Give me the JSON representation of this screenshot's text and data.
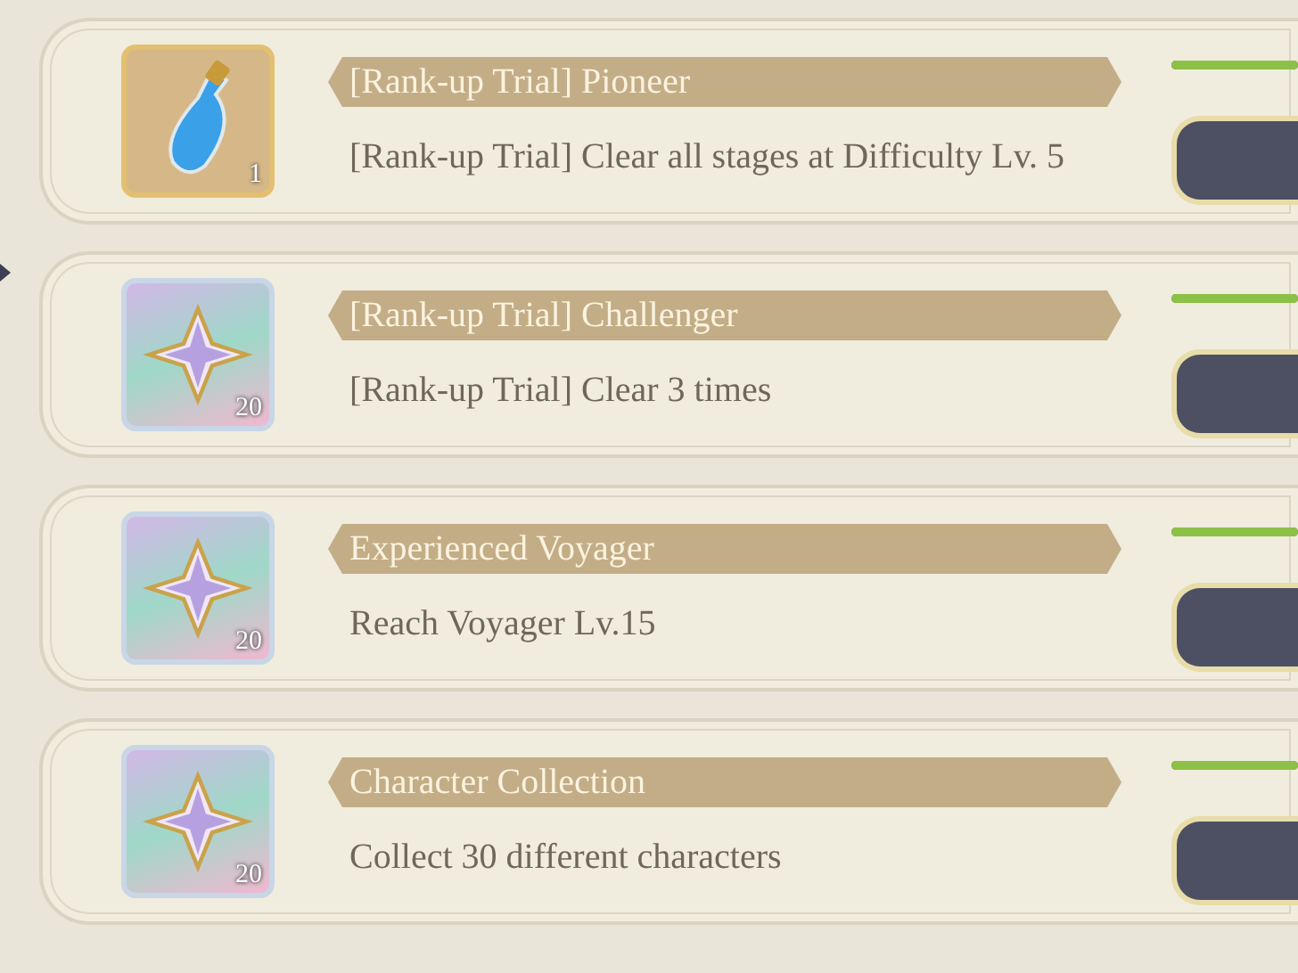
{
  "quests": [
    {
      "reward": {
        "kind": "potion",
        "count": "1"
      },
      "title": "[Rank-up Trial] Pioneer",
      "description": "[Rank-up Trial] Clear all stages at Difficulty Lv. 5",
      "progress": {
        "level": 1
      }
    },
    {
      "reward": {
        "kind": "crystal",
        "count": "20"
      },
      "title": "[Rank-up Trial] Challenger",
      "description": "[Rank-up Trial] Clear 3 times",
      "progress": {
        "level": 1
      }
    },
    {
      "reward": {
        "kind": "crystal",
        "count": "20"
      },
      "title": "Experienced Voyager",
      "description": "Reach Voyager Lv.15",
      "progress": {
        "level": 1
      }
    },
    {
      "reward": {
        "kind": "crystal",
        "count": "20"
      },
      "title": "Character Collection",
      "description": "Collect 30 different characters",
      "progress": {
        "level": 1
      }
    }
  ]
}
